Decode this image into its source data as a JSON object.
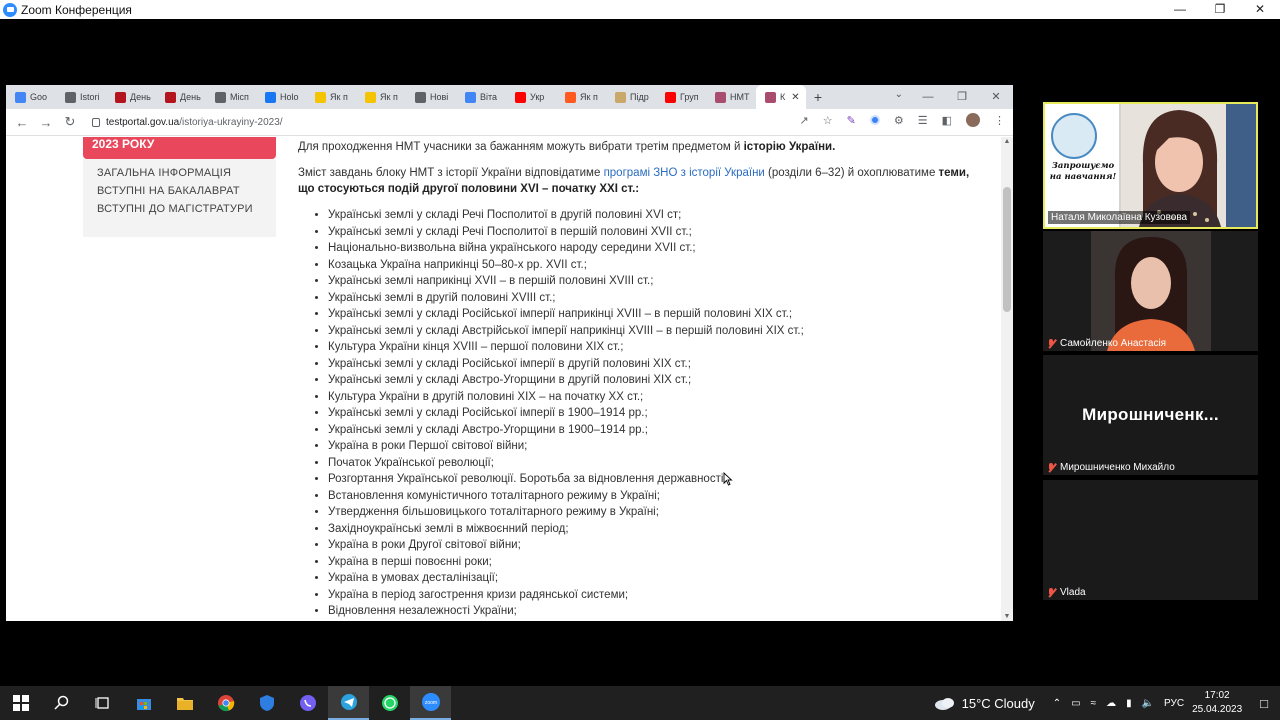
{
  "zoom": {
    "title": "Zoom Конференция"
  },
  "browser": {
    "tabs": [
      {
        "label": "Goo",
        "color": "#4285f4"
      },
      {
        "label": "Istori",
        "color": "#5f6368"
      },
      {
        "label": "День",
        "color": "#b3141d"
      },
      {
        "label": "День",
        "color": "#b3141d"
      },
      {
        "label": "Місп",
        "color": "#5f6368"
      },
      {
        "label": "Holo",
        "color": "#1877f2"
      },
      {
        "label": "Як п",
        "color": "#f5c400"
      },
      {
        "label": "Як п",
        "color": "#f5c400"
      },
      {
        "label": "Нові",
        "color": "#5f6368"
      },
      {
        "label": "Віта",
        "color": "#4285f4"
      },
      {
        "label": "Укр",
        "color": "#ff0000"
      },
      {
        "label": "Як п",
        "color": "#ff5a1f"
      },
      {
        "label": "Підр",
        "color": "#c9a86a"
      },
      {
        "label": "Груп",
        "color": "#ff0000"
      },
      {
        "label": "НМТ",
        "color": "#a84d6d"
      },
      {
        "label": "К",
        "color": "#a84d6d",
        "active": true
      }
    ],
    "url_host": "testportal.gov.ua",
    "url_path": "/istoriya-ukrayiny-2023/"
  },
  "sidebar": {
    "header": "2023 РОКУ",
    "items": [
      "ЗАГАЛЬНА ІНФОРМАЦІЯ",
      "ВСТУПНІ НА БАКАЛАВРАТ",
      "ВСТУПНІ ДО МАГІСТРАТУРИ"
    ]
  },
  "content": {
    "p1_text": "Для проходження НМТ учасники за бажанням можуть вибрати третім предметом й ",
    "p1_bold": "історію України.",
    "p2_text1": "Зміст завдань блоку НМТ з історії України відповідатиме ",
    "p2_link": "програмі ЗНО з історії України",
    "p2_text2": " (розділи 6–32) й охоплюватиме ",
    "p2_bold": "теми, що стосуються подій другої половини XVI – початку XXI ст.:",
    "list": [
      "Українські землі у складі Речі Посполитої в другій половині XVI ст;",
      "Українські землі у складі Речі Посполитої в першій половині XVII ст.;",
      "Національно-визвольна війна українського народу середини XVII ст.;",
      "Козацька Україна наприкінці 50–80-х рр. XVII ст.;",
      "Українські землі наприкінці XVII – в першій половині XVIII ст.;",
      "Українські землі в другій половині XVIII ст.;",
      "Українські землі у складі Російської імперії наприкінці XVIII – в першій половині XIX ст.;",
      "Українські землі у складі Австрійської імперії наприкінці XVIII – в першій половині XIX ст.;",
      "Культура України кінця XVIII – першої половини XIX ст.;",
      "Українські землі у складі Російської імперії в другій половині XIX ст.;",
      "Українські землі у складі Австро-Угорщини в другій половині XIX ст.;",
      "Культура України в другій половині XIX – на початку XX ст.;",
      "Українські землі у складі Російської імперії в 1900–1914 рр.;",
      "Українські землі у складі Австро-Угорщини в 1900–1914 рр.;",
      "Україна в роки Першої світової війни;",
      "Початок Української революції;",
      "Розгортання Української революції. Боротьба за відновлення державності;",
      "Встановлення комуністичного тоталітарного режиму в Україні;",
      "Утвердження більшовицького тоталітарного режиму в Україні;",
      "Західноукраїнські землі в міжвоєнний період;",
      "Україна в роки Другої світової війни;",
      "Україна в перші повоєнні роки;",
      "Україна в умовах десталінізації;",
      "Україна в період загострення кризи радянської системи;",
      "Відновлення незалежності України;"
    ]
  },
  "participants": [
    {
      "name": "Наталя Миколаївна Кузовова",
      "banner": "Запрошуємо на навчання!",
      "active_speaker": true
    },
    {
      "name": "Самойленко Анастасія",
      "muted": true
    },
    {
      "name": "Мирошниченко Михайло",
      "display": "Мирошниченк...",
      "muted": true
    },
    {
      "name": "Vlada",
      "muted": true
    }
  ],
  "taskbar": {
    "weather": "15°C  Cloudy",
    "lang": "РУС",
    "time": "17:02",
    "date": "25.04.2023"
  }
}
